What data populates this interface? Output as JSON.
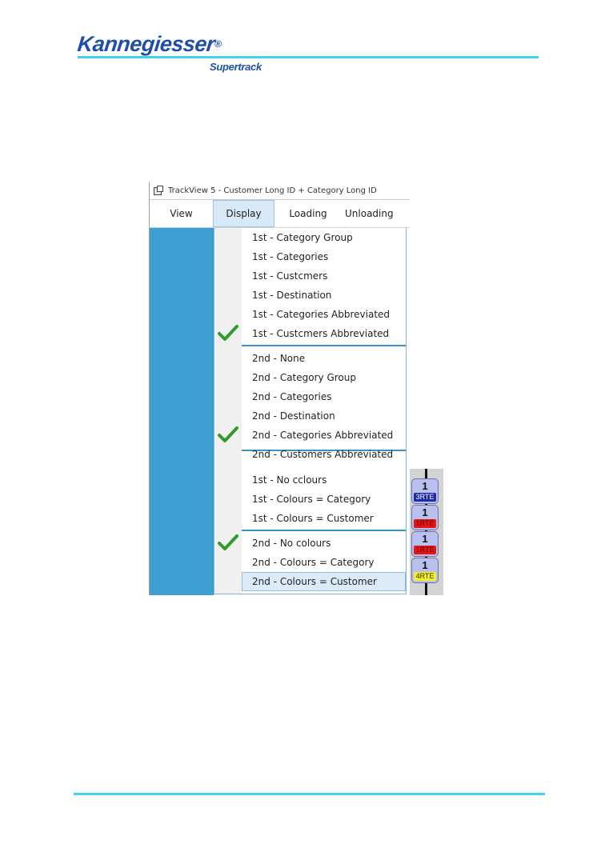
{
  "brand": {
    "logo": "Kannegiesser",
    "registered_mark": "®",
    "product": "Supertrack",
    "accent": "#3fd3ef"
  },
  "window": {
    "title": "TrackView 5 - Customer Long ID + Category Long ID"
  },
  "menubar": [
    {
      "label": "View"
    },
    {
      "label": "Display",
      "active": true
    },
    {
      "label": "Loading"
    },
    {
      "label": "Unloading"
    }
  ],
  "dropdown": {
    "items": [
      {
        "label": "1st - Category Group",
        "checked": false
      },
      {
        "label": "1st - Categories",
        "checked": false
      },
      {
        "label": "1st - Custcmers",
        "checked": false
      },
      {
        "label": "1st - Destination",
        "checked": false
      },
      {
        "label": "1st - Categories Abbreviated",
        "checked": false
      },
      {
        "label": "1st - Custcmers Abbreviated",
        "checked": true
      },
      {
        "label": "2nd - None",
        "checked": false
      },
      {
        "label": "2nd - Category Group",
        "checked": false
      },
      {
        "label": "2nd - Categories",
        "checked": false
      },
      {
        "label": "2nd - Destination",
        "checked": false
      },
      {
        "label": "2nd - Categories Abbreviated",
        "checked": true
      },
      {
        "label": "2nd - Customers Abbreviated",
        "checked": false
      },
      {
        "label": "1st - No cclours",
        "checked": false
      },
      {
        "label": "1st - Colours = Category",
        "checked": false
      },
      {
        "label": "1st - Colours = Customer",
        "checked": false
      },
      {
        "label": "2nd - No colours",
        "checked": true
      },
      {
        "label": "2nd - Colours = Category",
        "checked": false
      },
      {
        "label": "2nd - Colours = Customer",
        "checked": false,
        "highlighted": true
      }
    ]
  },
  "carousel": {
    "slots": [
      {
        "count": "1",
        "label": "3RTE",
        "color": "#1f2aa8",
        "text_color": "#ffffff"
      },
      {
        "count": "1",
        "label": "1RTE",
        "color": "#e81515",
        "text_color": "#5a0000"
      },
      {
        "count": "1",
        "label": "1RTE",
        "color": "#e81515",
        "text_color": "#5a0000"
      },
      {
        "count": "1",
        "label": "4RTE",
        "color": "#f5ef2a",
        "text_color": "#333300"
      }
    ]
  }
}
